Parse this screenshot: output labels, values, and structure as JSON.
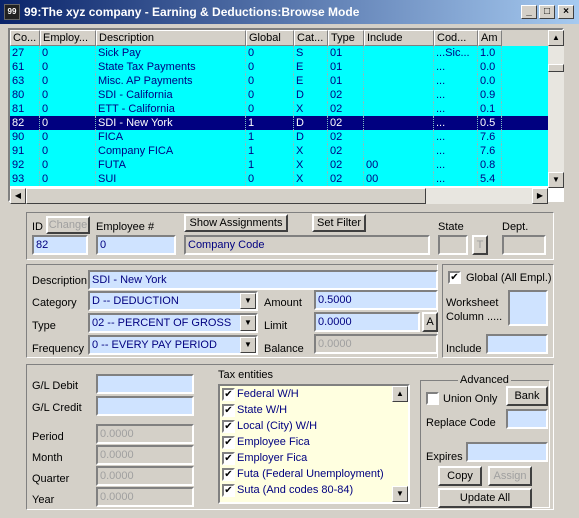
{
  "window": {
    "title": "99:The xyz company - Earning & Deductions:Browse Mode",
    "app_icon": "99"
  },
  "grid": {
    "columns": [
      "Co...",
      "Employ...",
      "Description",
      "Global",
      "Cat...",
      "Type",
      "Include",
      "Cod...",
      "Am"
    ],
    "rows": [
      [
        "27",
        "0",
        "Sick Pay",
        "0",
        "S",
        "01",
        "",
        "...Sic...",
        "1.0"
      ],
      [
        "61",
        "0",
        "State Tax Payments",
        "0",
        "E",
        "01",
        "",
        "...",
        "0.0"
      ],
      [
        "63",
        "0",
        "Misc. AP Payments",
        "0",
        "E",
        "01",
        "",
        "...",
        "0.0"
      ],
      [
        "80",
        "0",
        "SDI - California",
        "0",
        "D",
        "02",
        "",
        "...",
        "0.9"
      ],
      [
        "81",
        "0",
        "ETT - California",
        "0",
        "X",
        "02",
        "",
        "...",
        "0.1"
      ],
      [
        "82",
        "0",
        "SDI - New York",
        "1",
        "D",
        "02",
        "",
        "...",
        "0.5"
      ],
      [
        "90",
        "0",
        "FICA",
        "1",
        "D",
        "02",
        "",
        "...",
        "7.6"
      ],
      [
        "91",
        "0",
        "Company FICA",
        "1",
        "X",
        "02",
        "",
        "...",
        "7.6"
      ],
      [
        "92",
        "0",
        "FUTA",
        "1",
        "X",
        "02",
        "00",
        "...",
        "0.8"
      ],
      [
        "93",
        "0",
        "SUI",
        "0",
        "X",
        "02",
        "00",
        "...",
        "5.4"
      ]
    ],
    "selected_index": 5
  },
  "top": {
    "id_label": "ID",
    "change_label": "Change",
    "employee_label": "Employee #",
    "show_assignments": "Show Assignments",
    "set_filter": "Set Filter",
    "state_label": "State",
    "dept_label": "Dept.",
    "id_value": "82",
    "employee_value": "0",
    "company_code": "Company Code",
    "t_button": "T"
  },
  "detail": {
    "description_label": "Description",
    "description_value": "SDI - New York",
    "category_label": "Category",
    "category_value": "D -- DEDUCTION",
    "type_label": "Type",
    "type_value": "02 -- PERCENT OF GROSS",
    "frequency_label": "Frequency",
    "frequency_value": "0 -- EVERY PAY PERIOD",
    "amount_label": "Amount",
    "amount_value": "0.5000",
    "limit_label": "Limit",
    "limit_value": "0.0000",
    "a_button": "A",
    "balance_label": "Balance",
    "balance_value": "0.0000",
    "global_label": "Global (All Empl.)",
    "global_checked": true,
    "worksheet_label": "Worksheet Column .....",
    "include_label": "Include"
  },
  "gl": {
    "debit_label": "G/L Debit",
    "credit_label": "G/L Credit",
    "period_label": "Period",
    "period_value": "0.0000",
    "month_label": "Month",
    "month_value": "0.0000",
    "quarter_label": "Quarter",
    "quarter_value": "0.0000",
    "year_label": "Year",
    "year_value": "0.0000"
  },
  "tax": {
    "label": "Tax entities",
    "items": [
      {
        "label": "Federal W/H",
        "checked": true
      },
      {
        "label": "State W/H",
        "checked": true
      },
      {
        "label": "Local (City) W/H",
        "checked": true
      },
      {
        "label": "Employee Fica",
        "checked": true
      },
      {
        "label": "Employer Fica",
        "checked": true
      },
      {
        "label": "Futa (Federal Unemployment)",
        "checked": true
      },
      {
        "label": "Suta (And codes 80-84)",
        "checked": true
      }
    ]
  },
  "advanced": {
    "label": "Advanced",
    "union_only": "Union Only",
    "bank": "Bank",
    "replace_code": "Replace Code",
    "expires": "Expires",
    "copy": "Copy",
    "assign": "Assign",
    "update_all": "Update All"
  },
  "colors": {
    "grid_row": "#00ffff",
    "selected_row": "#000080",
    "field": "#cfe3ff"
  }
}
